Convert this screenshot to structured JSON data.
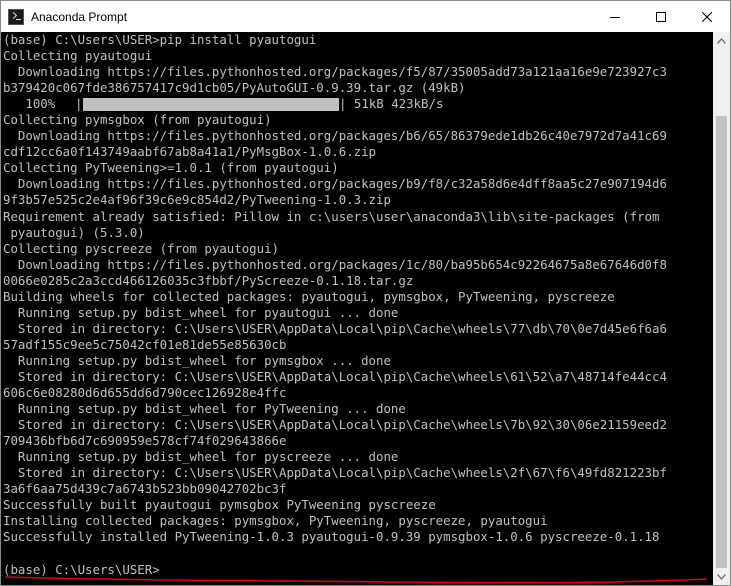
{
  "window": {
    "title": "Anaconda Prompt"
  },
  "terminal": {
    "lines": [
      "(base) C:\\Users\\USER>pip install pyautogui",
      "Collecting pyautogui",
      "  Downloading https://files.pythonhosted.org/packages/f5/87/35005add73a121aa16e9e723927c3",
      "b379420c067fde386757417c9d1cb05/PyAutoGUI-0.9.39.tar.gz (49kB)",
      "__PROGRESS__",
      "Collecting pymsgbox (from pyautogui)",
      "  Downloading https://files.pythonhosted.org/packages/b6/65/86379ede1db26c40e7972d7a41c69",
      "cdf12cc6a0f143749aabf67ab8a41a1/PyMsgBox-1.0.6.zip",
      "Collecting PyTweening>=1.0.1 (from pyautogui)",
      "  Downloading https://files.pythonhosted.org/packages/b9/f8/c32a58d6e4dff8aa5c27e907194d6",
      "9f3b57e525c2e4af96f39c6e9c854d2/PyTweening-1.0.3.zip",
      "Requirement already satisfied: Pillow in c:\\users\\user\\anaconda3\\lib\\site-packages (from",
      " pyautogui) (5.3.0)",
      "Collecting pyscreeze (from pyautogui)",
      "  Downloading https://files.pythonhosted.org/packages/1c/80/ba95b654c92264675a8e67646d0f8",
      "0066e0285c2a3ccd466126035c3fbbf/PyScreeze-0.1.18.tar.gz",
      "Building wheels for collected packages: pyautogui, pymsgbox, PyTweening, pyscreeze",
      "  Running setup.py bdist_wheel for pyautogui ... done",
      "  Stored in directory: C:\\Users\\USER\\AppData\\Local\\pip\\Cache\\wheels\\77\\db\\70\\0e7d45e6f6a6",
      "57adf155c9ee5c75042cf01e81de55e85630cb",
      "  Running setup.py bdist_wheel for pymsgbox ... done",
      "  Stored in directory: C:\\Users\\USER\\AppData\\Local\\pip\\Cache\\wheels\\61\\52\\a7\\48714fe44cc4",
      "606c6e08280d6d655dd6d790cec126928e4ffc",
      "  Running setup.py bdist_wheel for PyTweening ... done",
      "  Stored in directory: C:\\Users\\USER\\AppData\\Local\\pip\\Cache\\wheels\\7b\\92\\30\\06e21159eed2",
      "709436bfb6d7c690959e578cf74f029643866e",
      "  Running setup.py bdist_wheel for pyscreeze ... done",
      "  Stored in directory: C:\\Users\\USER\\AppData\\Local\\pip\\Cache\\wheels\\2f\\67\\f6\\49fd821223bf",
      "3a6f6aa75d439c7a6743b523bb09042702bc3f",
      "Successfully built pyautogui pymsgbox PyTweening pyscreeze",
      "Installing collected packages: pymsgbox, PyTweening, pyscreeze, pyautogui",
      "Successfully installed PyTweening-1.0.3 pyautogui-0.9.39 pymsgbox-1.0.6 pyscreeze-0.1.18",
      "",
      "(base) C:\\Users\\USER>"
    ],
    "progress": {
      "percent_label": "   100%",
      "open_bracket": "|",
      "close_bracket": "| 51kB 423kB/s",
      "fraction": 1.0
    },
    "text_color": "#c0c0c0",
    "background": "#000000",
    "annotation_color": "#e00000"
  },
  "scrollbar": {
    "position_fraction": 1.0
  }
}
